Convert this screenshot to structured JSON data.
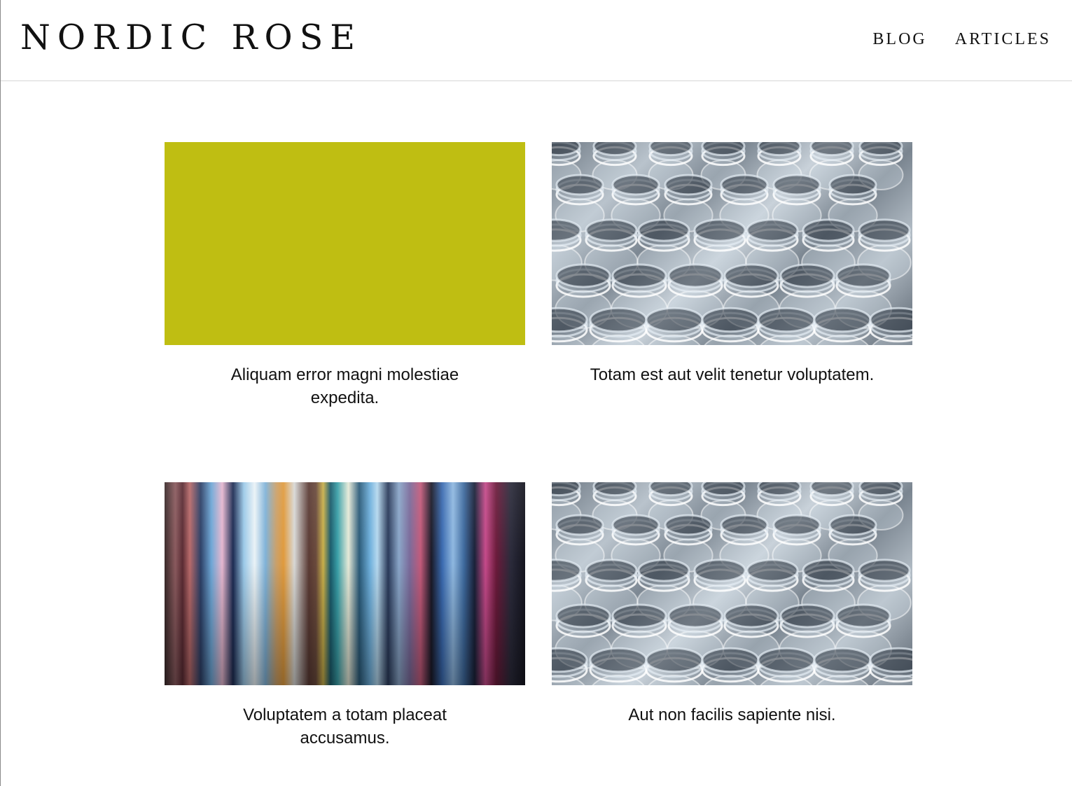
{
  "header": {
    "logo": "NORDIC ROSE",
    "nav": [
      {
        "label": "BLOG"
      },
      {
        "label": "ARTICLES"
      }
    ]
  },
  "posts": [
    {
      "title": "Aliquam error magni molestiae expedita.",
      "image": "solid-color",
      "color": "#bfbe12"
    },
    {
      "title": "Totam est aut velit tenetur voluptatem.",
      "image": "glass-bottles-photo"
    },
    {
      "title": "Voluptatem a totam placeat accusamus.",
      "image": "color-streaks-photo"
    },
    {
      "title": "Aut non facilis sapiente nisi.",
      "image": "glass-bottles-photo"
    }
  ]
}
